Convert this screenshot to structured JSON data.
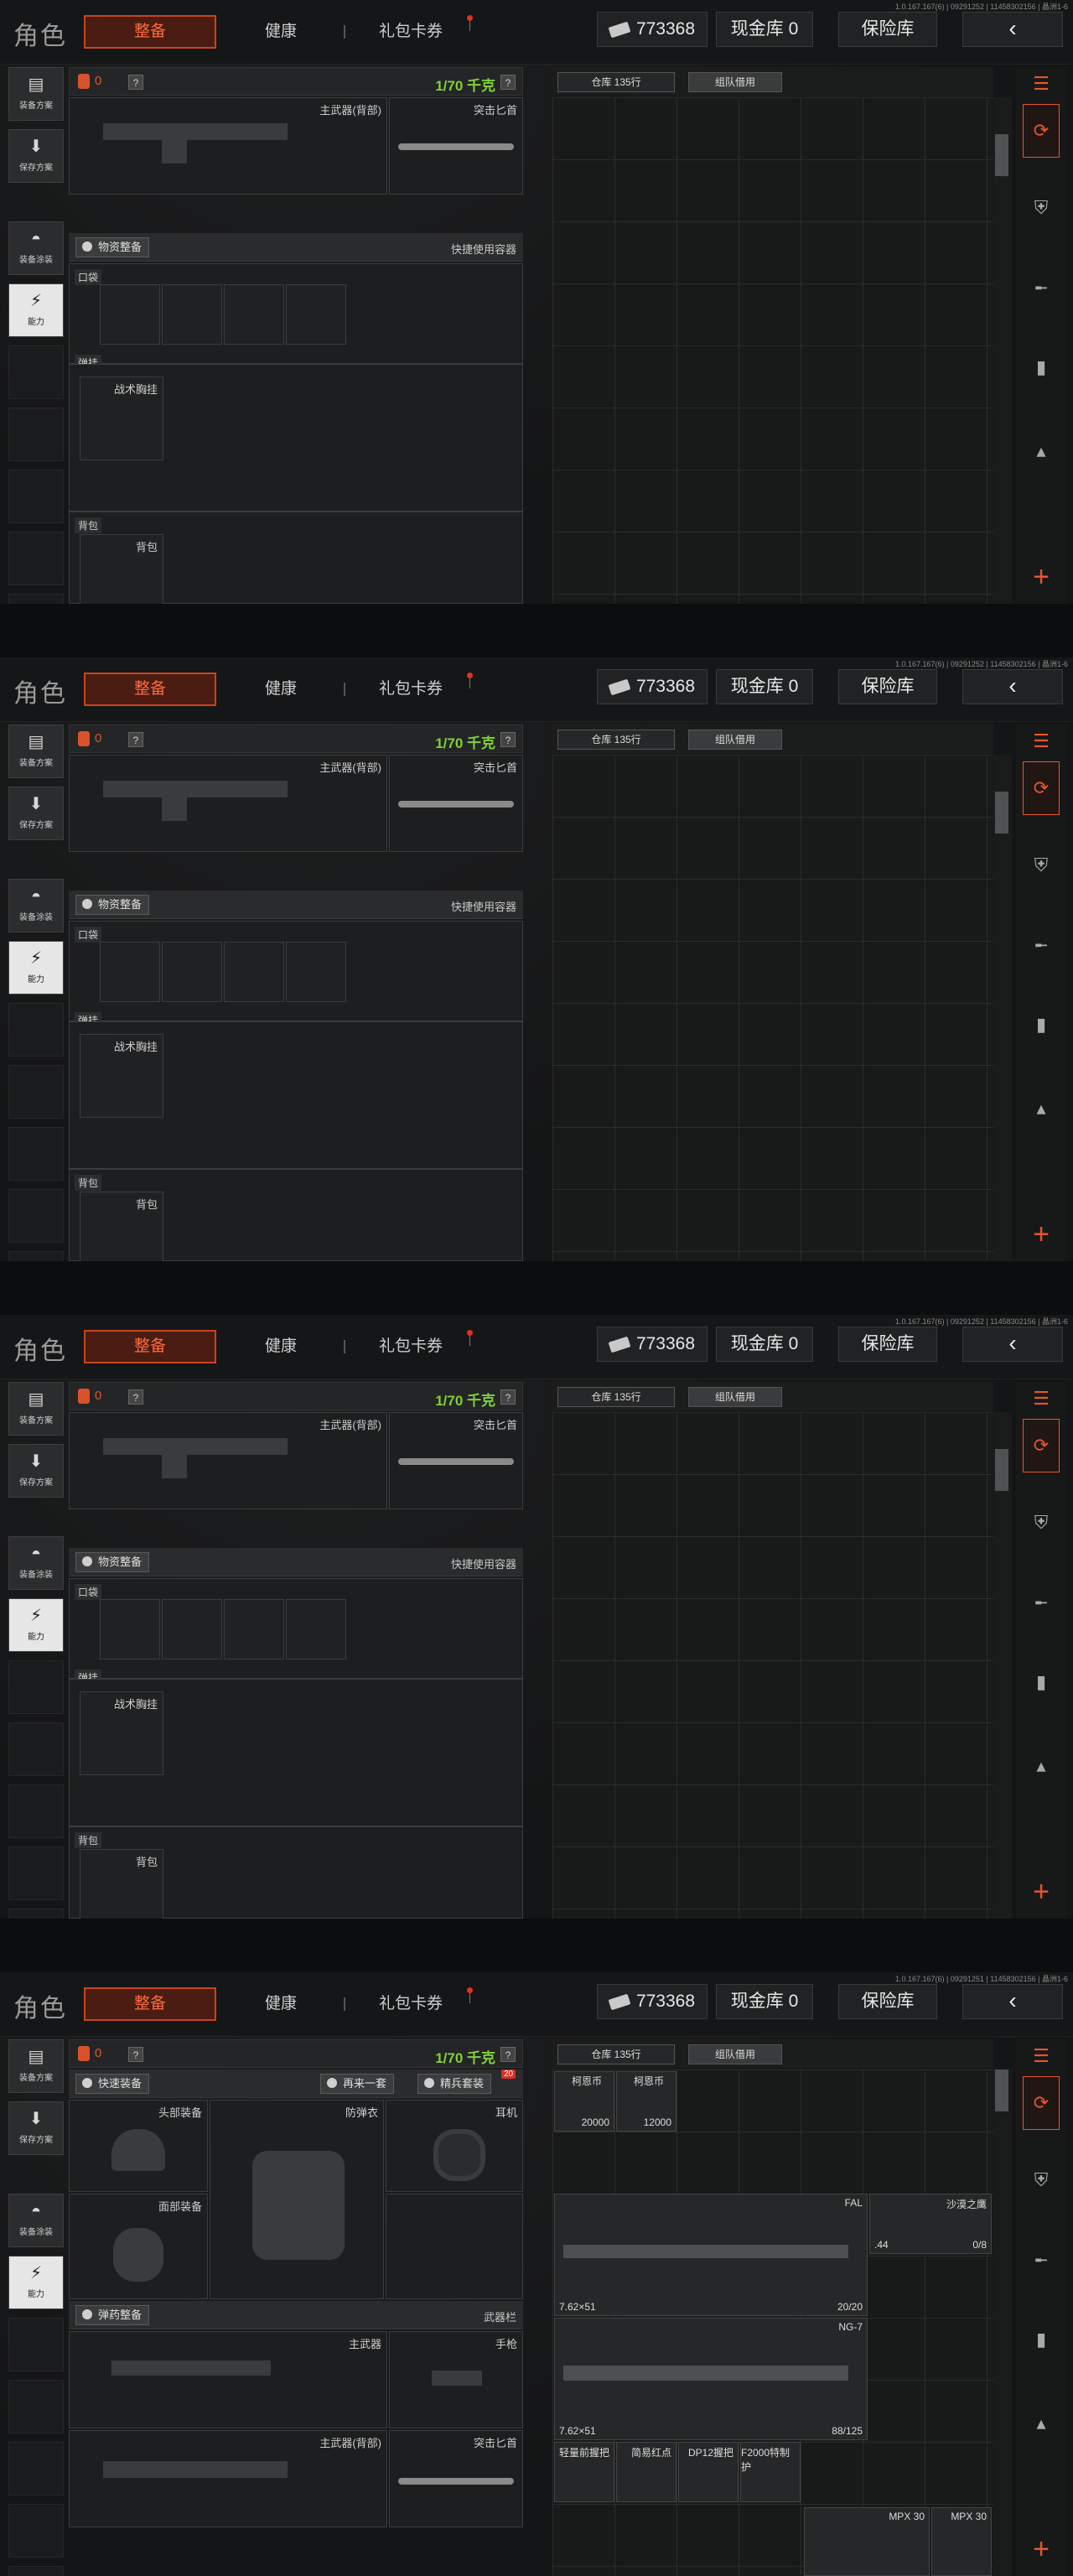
{
  "build": "1.0.167.167(6) | 09291252 | 11458302156 | 晶洲1-6",
  "build4": "1.0.167.167(6) | 09291251 | 11458302156 | 晶洲1-6",
  "header": {
    "game_title": "角色",
    "tabs": [
      "整备",
      "健康",
      "礼包卡券"
    ],
    "money": "773368",
    "cash_label": "现金库 0",
    "vault_label": "保险库",
    "back_icon": "‹"
  },
  "leftnav": {
    "items": [
      {
        "label": "装备方案",
        "icon": "armor-icon"
      },
      {
        "label": "保存方案",
        "icon": "download-icon"
      },
      {
        "label": "装备涂装",
        "icon": "helmet-icon"
      },
      {
        "label": "能力",
        "icon": "energy-icon"
      }
    ]
  },
  "panel": {
    "count": "0",
    "question": "?",
    "weight": "1/70 千克",
    "slots": {
      "primary_back": "主武器(背部)",
      "knife": "突击匕首",
      "primary": "主武器",
      "pistol": "手枪"
    },
    "bars": {
      "supplies": "物资整备",
      "quick_container": "快捷使用容器",
      "quick_equip": "快速装备",
      "buy_again": "再来一套",
      "elite_set": "精兵套装",
      "elite_badge": "20",
      "ammo": "弹药整备",
      "weapon_slot": "武器栏"
    },
    "sections": {
      "pocket": "口袋",
      "rig": "弹挂",
      "rig_item": "战术胸挂",
      "backpack": "背包",
      "backpack_item": "背包"
    },
    "gear": {
      "helmet": "头部装备",
      "armor": "防弹衣",
      "ear": "耳机",
      "face": "面部装备"
    }
  },
  "warehouse": {
    "tab1": "仓库 135行",
    "tab2": "组队借用",
    "items": {
      "coin1_name": "柯恩币",
      "coin1_val": "20000",
      "coin2_name": "柯恩币",
      "coin2_val": "12000",
      "fal_name": "FAL",
      "fal_ammo": "7.62×51",
      "fal_count": "20/20",
      "deagle_name": "沙漠之鹰",
      "deagle_cal": ".44",
      "deagle_count": "0/8",
      "ng7_name": "NG-7",
      "ng7_ammo": "7.62×51",
      "ng7_count": "88/125",
      "att1": "轻量前握把",
      "att2": "简易红点",
      "att3": "DP12握把",
      "att4": "F2000特制护",
      "mpx1": "MPX 30",
      "mpx2": "MPX 30"
    }
  },
  "colors": {
    "accent": "#e8552c",
    "weight": "#7fd13a"
  }
}
